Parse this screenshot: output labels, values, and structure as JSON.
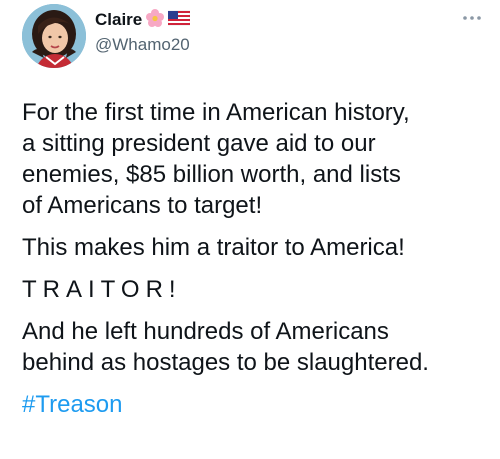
{
  "author": {
    "display_name": "Claire",
    "handle": "@Whamo20",
    "badges": [
      "pink-flower-icon",
      "us-flag-icon"
    ]
  },
  "more_icon": "more-horizontal-icon",
  "tweet": {
    "paragraph_1_line_1": "For the first time in American history,",
    "paragraph_1_line_2": "a sitting president gave aid to our",
    "paragraph_1_line_3": "enemies, $85 billion worth, and lists",
    "paragraph_1_line_4": "of Americans to target!",
    "paragraph_2": "This makes him a traitor to America!",
    "paragraph_3": "TRAITOR!",
    "paragraph_4_line_1": "And he left hundreds of Americans",
    "paragraph_4_line_2": "behind as hostages to be slaughtered.",
    "hashtag": "#Treason"
  },
  "colors": {
    "text": "#0f1419",
    "secondary": "#536471",
    "link": "#1d9bf0"
  }
}
